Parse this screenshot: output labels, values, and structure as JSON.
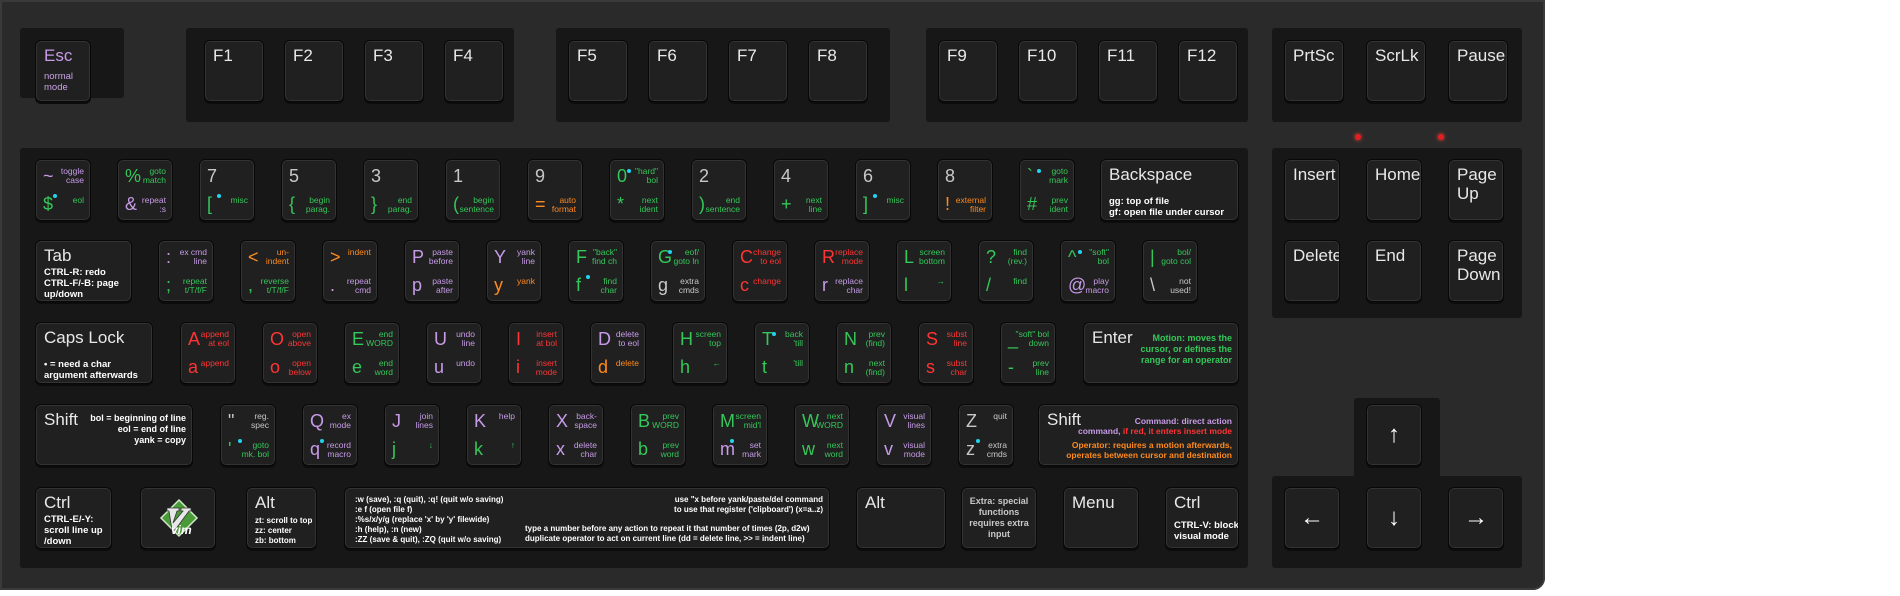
{
  "fn_row": [
    {
      "id": "esc",
      "main": "Esc",
      "sub": "normal\nmode"
    },
    {
      "id": "f1",
      "main": "F1"
    },
    {
      "id": "f2",
      "main": "F2"
    },
    {
      "id": "f3",
      "main": "F3"
    },
    {
      "id": "f4",
      "main": "F4"
    },
    {
      "id": "f5",
      "main": "F5"
    },
    {
      "id": "f6",
      "main": "F6"
    },
    {
      "id": "f7",
      "main": "F7"
    },
    {
      "id": "f8",
      "main": "F8"
    },
    {
      "id": "f9",
      "main": "F9"
    },
    {
      "id": "f10",
      "main": "F10"
    },
    {
      "id": "f11",
      "main": "F11"
    },
    {
      "id": "f12",
      "main": "F12"
    },
    {
      "id": "prtsc",
      "main": "PrtSc"
    },
    {
      "id": "scrlk",
      "main": "ScrLk"
    },
    {
      "id": "pause",
      "main": "Pause"
    }
  ],
  "num_row": [
    {
      "top": "~",
      "top_desc": "toggle\ncase",
      "bot": "$",
      "bot_desc": "eol"
    },
    {
      "top": "%",
      "top_desc": "goto\nmatch",
      "bot": "&",
      "bot_desc": "repeat\n:s"
    },
    {
      "top": "7",
      "top_desc": "",
      "bot": "[",
      "bot_desc": "misc"
    },
    {
      "top": "5",
      "top_desc": "",
      "bot": "{",
      "bot_desc": "begin\nparag."
    },
    {
      "top": "3",
      "top_desc": "",
      "bot": "}",
      "bot_desc": "end\nparag."
    },
    {
      "top": "1",
      "top_desc": "",
      "bot": "(",
      "bot_desc": "begin\nsentence"
    },
    {
      "top": "9",
      "top_desc": "",
      "bot": "=",
      "bot_desc": "auto\nformat"
    },
    {
      "top": "0",
      "top_desc": "\"hard\"\nbol",
      "bot": "*",
      "bot_desc": "next\nident"
    },
    {
      "top": "2",
      "top_desc": "",
      "bot": ")",
      "bot_desc": "end\nsentence"
    },
    {
      "top": "4",
      "top_desc": "",
      "bot": "+",
      "bot_desc": "next\nline"
    },
    {
      "top": "6",
      "top_desc": "",
      "bot": "]",
      "bot_desc": "misc"
    },
    {
      "top": "8",
      "top_desc": "",
      "bot": "!",
      "bot_desc": "external\nfilter"
    },
    {
      "top": "`",
      "top_desc": "goto\nmark",
      "bot": "#",
      "bot_desc": "prev\nident"
    }
  ],
  "backspace": {
    "main": "Backspace",
    "desc": "gg: top of file\ngf: open file under cursor"
  },
  "nav1": [
    {
      "main": "Insert"
    },
    {
      "main": "Home"
    },
    {
      "main": "Page\nUp"
    }
  ],
  "nav2": [
    {
      "main": "Delete"
    },
    {
      "main": "End"
    },
    {
      "main": "Page\nDown"
    }
  ],
  "tab": {
    "main": "Tab",
    "desc": "CTRL-R: redo\nCTRL-F/-B: page\nup/down"
  },
  "qrow": [
    {
      "top": ":",
      "top_desc": "ex cmd\nline",
      "bot": ";",
      "bot_desc": "repeat\nt/T/f/F"
    },
    {
      "top": "<",
      "top_desc": "un-\nindent",
      "bot": ",",
      "bot_desc": "reverse\nt/T/f/F"
    },
    {
      "top": ">",
      "top_desc": "indent",
      "bot": ".",
      "bot_desc": "repeat\ncmd"
    },
    {
      "top": "P",
      "top_desc": "paste\nbefore",
      "bot": "p",
      "bot_desc": "paste\nafter"
    },
    {
      "top": "Y",
      "top_desc": "yank\nline",
      "bot": "y",
      "bot_desc": "yank"
    },
    {
      "top": "F",
      "top_desc": "\"back\"\nfind ch",
      "bot": "f",
      "bot_desc": "find\nchar"
    },
    {
      "top": "G",
      "top_desc": "eof/\ngoto ln",
      "bot": "g",
      "bot_desc": "extra\ncmds"
    },
    {
      "top": "C",
      "top_desc": "change\nto eol",
      "bot": "c",
      "bot_desc": "change"
    },
    {
      "top": "R",
      "top_desc": "replace\nmode",
      "bot": "r",
      "bot_desc": "replace\nchar"
    },
    {
      "top": "L",
      "top_desc": "screen\nbottom",
      "bot": "l",
      "bot_desc": "→"
    },
    {
      "top": "?",
      "top_desc": "find\n(rev.)",
      "bot": "/",
      "bot_desc": "find"
    },
    {
      "top": "^",
      "top_desc": "\"soft\"\nbol",
      "bot": "@",
      "bot_desc": "play\nmacro"
    },
    {
      "top": "|",
      "top_desc": "bol/\ngoto col",
      "bot": "\\",
      "bot_desc": "not\nused!"
    }
  ],
  "caps": {
    "main": "Caps Lock",
    "desc": "• = need a char\nargument afterwards"
  },
  "arow": [
    {
      "top": "A",
      "top_desc": "append\nat eol",
      "bot": "a",
      "bot_desc": "append"
    },
    {
      "top": "O",
      "top_desc": "open\nabove",
      "bot": "o",
      "bot_desc": "open\nbelow"
    },
    {
      "top": "E",
      "top_desc": "end\nWORD",
      "bot": "e",
      "bot_desc": "end\nword"
    },
    {
      "top": "U",
      "top_desc": "undo\nline",
      "bot": "u",
      "bot_desc": "undo"
    },
    {
      "top": "I",
      "top_desc": "insert\nat bol",
      "bot": "i",
      "bot_desc": "insert\nmode"
    },
    {
      "top": "D",
      "top_desc": "delete\nto eol",
      "bot": "d",
      "bot_desc": "delete"
    },
    {
      "top": "H",
      "top_desc": "screen\ntop",
      "bot": "h",
      "bot_desc": "←"
    },
    {
      "top": "T",
      "top_desc": "back\n'till",
      "bot": "t",
      "bot_desc": "'till"
    },
    {
      "top": "N",
      "top_desc": "prev\n(find)",
      "bot": "n",
      "bot_desc": "next\n(find)"
    },
    {
      "top": "S",
      "top_desc": "subst\nline",
      "bot": "s",
      "bot_desc": "subst\nchar"
    },
    {
      "top": "_",
      "top_desc": "\"soft\" bol\ndown",
      "bot": "-",
      "bot_desc": "prev\nline"
    }
  ],
  "enter": {
    "main": "Enter",
    "desc": "Motion: moves the\ncursor, or defines the\nrange for an operator"
  },
  "lshift": {
    "main": "Shift",
    "desc": "bol = beginning of line\neol = end of line\nyank = copy"
  },
  "zrow": [
    {
      "top": "\"",
      "top_desc": "reg.\nspec",
      "bot": "'",
      "bot_desc": "goto\nmk. bol"
    },
    {
      "top": "Q",
      "top_desc": "ex\nmode",
      "bot": "q",
      "bot_desc": "record\nmacro"
    },
    {
      "top": "J",
      "top_desc": "join\nlines",
      "bot": "j",
      "bot_desc": "↓"
    },
    {
      "top": "K",
      "top_desc": "help",
      "bot": "k",
      "bot_desc": "↑"
    },
    {
      "top": "X",
      "top_desc": "back-\nspace",
      "bot": "x",
      "bot_desc": "delete\nchar"
    },
    {
      "top": "B",
      "top_desc": "prev\nWORD",
      "bot": "b",
      "bot_desc": "prev\nword"
    },
    {
      "top": "M",
      "top_desc": "screen\nmid'l",
      "bot": "m",
      "bot_desc": "set\nmark"
    },
    {
      "top": "W",
      "top_desc": "next\nWORD",
      "bot": "w",
      "bot_desc": "next\nword"
    },
    {
      "top": "V",
      "top_desc": "visual\nlines",
      "bot": "v",
      "bot_desc": "visual\nmode"
    },
    {
      "top": "Z",
      "top_desc": "quit",
      "bot": "z",
      "bot_desc": "extra\ncmds"
    }
  ],
  "rshift": {
    "main": "Shift",
    "l1": "Command: direct action",
    "l2a": "command,",
    "l2b": " if red, it enters insert mode",
    "l3": "Operator: requires a motion afterwards,",
    "l4": "operates between cursor and destination"
  },
  "bottom": {
    "lctrl": {
      "main": "Ctrl",
      "desc": "CTRL-E/-Y:\nscroll line up\n/down"
    },
    "logo": "vim",
    "lalt": {
      "main": "Alt",
      "desc": "zt: scroll to top\nzz: center\nzb: bottom"
    },
    "space_left": ":w (save), :q (quit), :q! (quit w/o saving)\n:e f (open file f)\n:%s/x/y/g (replace 'x' by 'y' filewide)\n:h (help), :n (new)\n:ZZ (save & quit), :ZQ (quit w/o saving)",
    "space_right1": "use \"x before yank/paste/del command\nto use that register ('clipboard') (x=a..z)",
    "space_right2": "type a number before any action to repeat it that number of times (2p, d2w)\nduplicate operator to act on current line (dd = delete line, >> = indent line)",
    "ralt": {
      "main": "Alt"
    },
    "extra": "Extra: special\nfunctions\nrequires extra\ninput",
    "menu": {
      "main": "Menu"
    },
    "rctrl": {
      "main": "Ctrl",
      "desc": "CTRL-V: block\nvisual mode"
    }
  },
  "arrows": {
    "up": "↑",
    "left": "←",
    "down": "↓",
    "right": "→"
  },
  "colors": {
    "motion": "#34c759",
    "command": "#c79be8",
    "insert": "#ff3434",
    "operator": "#ff8a1e",
    "special": "#c8c8c8",
    "dot": "#22d3ee"
  }
}
